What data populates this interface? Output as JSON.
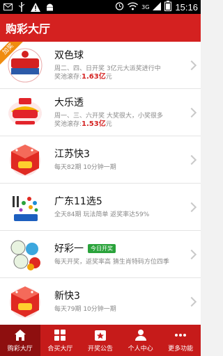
{
  "status_bar": {
    "time": "15:16",
    "network": "3G"
  },
  "header": {
    "title": "购彩大厅"
  },
  "lotteries": [
    {
      "name": "双色球",
      "badge": "加奖",
      "desc": "周二、四、日开奖 3亿元大派奖进行中",
      "pool_label": "奖池滚存:",
      "pool_amount": "1.63亿",
      "pool_unit": "元",
      "logo": "ssq-logo"
    },
    {
      "name": "大乐透",
      "desc": "周一、三、六开奖 大奖很大，小奖很多",
      "pool_label": "奖池滚存:",
      "pool_amount": "1.53亿",
      "pool_unit": "元",
      "logo": "dlt-logo"
    },
    {
      "name": "江苏快3",
      "desc": "每天82期  10分钟一期",
      "logo": "k3-logo"
    },
    {
      "name": "广东11选5",
      "desc": "全天84期 玩法简单  返奖率达59%",
      "logo": "11x5-logo"
    },
    {
      "name": "好彩一",
      "today_badge": "今日开奖",
      "desc": "每天开奖，返奖率高 猜生肖特码方位四季",
      "logo": "hc1-logo"
    },
    {
      "name": "新快3",
      "desc": "每天79期  10分钟一期",
      "logo": "xk3-logo"
    }
  ],
  "nav": [
    {
      "label": "购彩大厅",
      "icon": "home-icon",
      "active": true
    },
    {
      "label": "合买大厅",
      "icon": "grid-icon"
    },
    {
      "label": "开奖公告",
      "icon": "star-icon"
    },
    {
      "label": "个人中心",
      "icon": "person-icon"
    },
    {
      "label": "更多功能",
      "icon": "more-icon"
    }
  ],
  "colors": {
    "brand_red": "#d42120",
    "nav_active": "#8e0f0f",
    "prize_red": "#d42120",
    "badge_green": "#2aa33b",
    "badge_orange": "#f08c10"
  }
}
